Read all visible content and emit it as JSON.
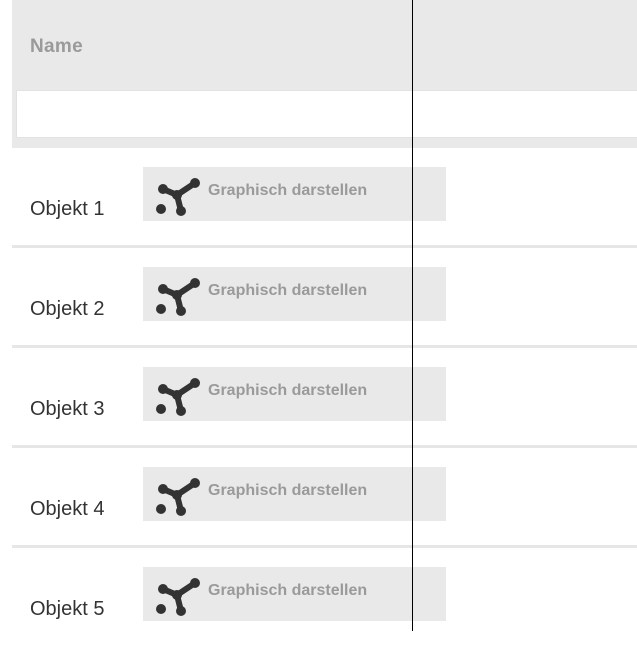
{
  "table": {
    "header": {
      "name_label": "Name"
    },
    "filter": {
      "value": "",
      "placeholder": ""
    },
    "rows": [
      {
        "label": "Objekt 1",
        "button_label": "Graphisch darstellen",
        "button_icon": "graph-nodes-icon"
      },
      {
        "label": "Objekt 2",
        "button_label": "Graphisch darstellen",
        "button_icon": "graph-nodes-icon"
      },
      {
        "label": "Objekt 3",
        "button_label": "Graphisch darstellen",
        "button_icon": "graph-nodes-icon"
      },
      {
        "label": "Objekt 4",
        "button_label": "Graphisch darstellen",
        "button_icon": "graph-nodes-icon"
      },
      {
        "label": "Objekt 5",
        "button_label": "Graphisch darstellen",
        "button_icon": "graph-nodes-icon"
      }
    ]
  },
  "colors": {
    "header_bg": "#e9e9e9",
    "header_text": "#9a9a9a",
    "row_text": "#333333",
    "button_bg": "#e9e9e9",
    "icon": "#333333",
    "separator": "#e6e6e6"
  }
}
